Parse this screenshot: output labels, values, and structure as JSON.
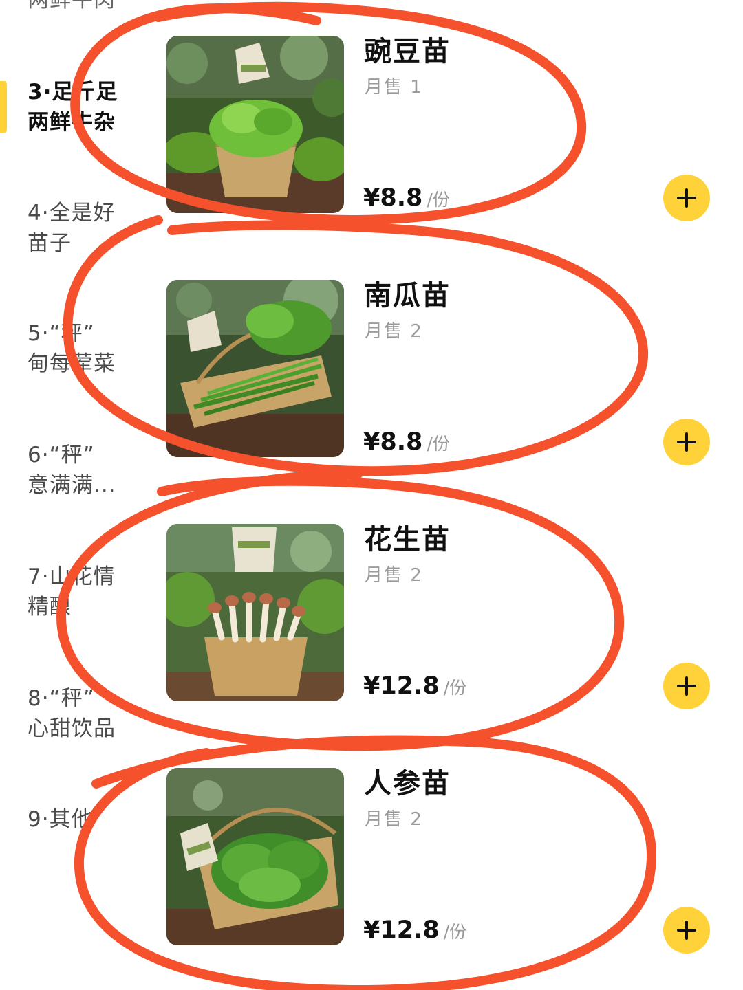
{
  "sidebar": {
    "top_partial": "两鲜牛肉",
    "categories": [
      {
        "line1": "3·足斤足",
        "line2": "两鲜牛杂",
        "active": true
      },
      {
        "line1": "4·全是好",
        "line2": "苗子"
      },
      {
        "line1": "5·“秤”",
        "line2": "甸每荤菜"
      },
      {
        "line1": "6·“秤”",
        "line2": "意满满..."
      },
      {
        "line1": "7·山花情",
        "line2": "精酿"
      },
      {
        "line1": "8·“秤”",
        "line2": "心甜饮品"
      },
      {
        "line1": "9·其他",
        "line2": ""
      }
    ]
  },
  "products": [
    {
      "name": "豌豆苗",
      "sales": "月售 1",
      "price": "¥8.8",
      "unit": "/份",
      "tag": "豌豆苗",
      "image": "pea-shoots-basket"
    },
    {
      "name": "南瓜苗",
      "sales": "月售 2",
      "price": "¥8.8",
      "unit": "/份",
      "tag": "南瓜苗",
      "image": "pumpkin-shoots-basket"
    },
    {
      "name": "花生苗",
      "sales": "月售 2",
      "price": "¥12.8",
      "unit": "/份",
      "tag": "花生苗",
      "image": "peanut-sprouts-basket"
    },
    {
      "name": "人参苗",
      "sales": "月售 2",
      "price": "¥12.8",
      "unit": "/份",
      "tag": "人参苗",
      "image": "ginseng-shoots-basket"
    }
  ],
  "colors": {
    "accent": "#ffd23a",
    "annotation": "#f4512c",
    "text_muted": "#9a9a9a"
  },
  "icons": {
    "add": "plus-icon"
  }
}
